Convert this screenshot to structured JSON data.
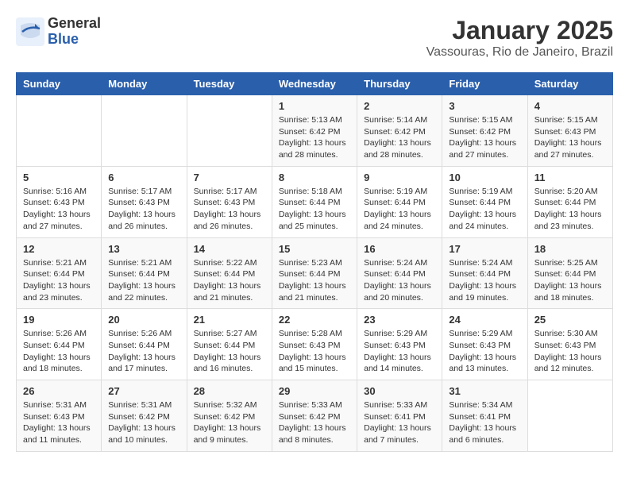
{
  "logo": {
    "general": "General",
    "blue": "Blue"
  },
  "title": "January 2025",
  "subtitle": "Vassouras, Rio de Janeiro, Brazil",
  "headers": [
    "Sunday",
    "Monday",
    "Tuesday",
    "Wednesday",
    "Thursday",
    "Friday",
    "Saturday"
  ],
  "weeks": [
    [
      {
        "day": "",
        "sunrise": "",
        "sunset": "",
        "daylight": ""
      },
      {
        "day": "",
        "sunrise": "",
        "sunset": "",
        "daylight": ""
      },
      {
        "day": "",
        "sunrise": "",
        "sunset": "",
        "daylight": ""
      },
      {
        "day": "1",
        "sunrise": "Sunrise: 5:13 AM",
        "sunset": "Sunset: 6:42 PM",
        "daylight": "Daylight: 13 hours and 28 minutes."
      },
      {
        "day": "2",
        "sunrise": "Sunrise: 5:14 AM",
        "sunset": "Sunset: 6:42 PM",
        "daylight": "Daylight: 13 hours and 28 minutes."
      },
      {
        "day": "3",
        "sunrise": "Sunrise: 5:15 AM",
        "sunset": "Sunset: 6:42 PM",
        "daylight": "Daylight: 13 hours and 27 minutes."
      },
      {
        "day": "4",
        "sunrise": "Sunrise: 5:15 AM",
        "sunset": "Sunset: 6:43 PM",
        "daylight": "Daylight: 13 hours and 27 minutes."
      }
    ],
    [
      {
        "day": "5",
        "sunrise": "Sunrise: 5:16 AM",
        "sunset": "Sunset: 6:43 PM",
        "daylight": "Daylight: 13 hours and 27 minutes."
      },
      {
        "day": "6",
        "sunrise": "Sunrise: 5:17 AM",
        "sunset": "Sunset: 6:43 PM",
        "daylight": "Daylight: 13 hours and 26 minutes."
      },
      {
        "day": "7",
        "sunrise": "Sunrise: 5:17 AM",
        "sunset": "Sunset: 6:43 PM",
        "daylight": "Daylight: 13 hours and 26 minutes."
      },
      {
        "day": "8",
        "sunrise": "Sunrise: 5:18 AM",
        "sunset": "Sunset: 6:44 PM",
        "daylight": "Daylight: 13 hours and 25 minutes."
      },
      {
        "day": "9",
        "sunrise": "Sunrise: 5:19 AM",
        "sunset": "Sunset: 6:44 PM",
        "daylight": "Daylight: 13 hours and 24 minutes."
      },
      {
        "day": "10",
        "sunrise": "Sunrise: 5:19 AM",
        "sunset": "Sunset: 6:44 PM",
        "daylight": "Daylight: 13 hours and 24 minutes."
      },
      {
        "day": "11",
        "sunrise": "Sunrise: 5:20 AM",
        "sunset": "Sunset: 6:44 PM",
        "daylight": "Daylight: 13 hours and 23 minutes."
      }
    ],
    [
      {
        "day": "12",
        "sunrise": "Sunrise: 5:21 AM",
        "sunset": "Sunset: 6:44 PM",
        "daylight": "Daylight: 13 hours and 23 minutes."
      },
      {
        "day": "13",
        "sunrise": "Sunrise: 5:21 AM",
        "sunset": "Sunset: 6:44 PM",
        "daylight": "Daylight: 13 hours and 22 minutes."
      },
      {
        "day": "14",
        "sunrise": "Sunrise: 5:22 AM",
        "sunset": "Sunset: 6:44 PM",
        "daylight": "Daylight: 13 hours and 21 minutes."
      },
      {
        "day": "15",
        "sunrise": "Sunrise: 5:23 AM",
        "sunset": "Sunset: 6:44 PM",
        "daylight": "Daylight: 13 hours and 21 minutes."
      },
      {
        "day": "16",
        "sunrise": "Sunrise: 5:24 AM",
        "sunset": "Sunset: 6:44 PM",
        "daylight": "Daylight: 13 hours and 20 minutes."
      },
      {
        "day": "17",
        "sunrise": "Sunrise: 5:24 AM",
        "sunset": "Sunset: 6:44 PM",
        "daylight": "Daylight: 13 hours and 19 minutes."
      },
      {
        "day": "18",
        "sunrise": "Sunrise: 5:25 AM",
        "sunset": "Sunset: 6:44 PM",
        "daylight": "Daylight: 13 hours and 18 minutes."
      }
    ],
    [
      {
        "day": "19",
        "sunrise": "Sunrise: 5:26 AM",
        "sunset": "Sunset: 6:44 PM",
        "daylight": "Daylight: 13 hours and 18 minutes."
      },
      {
        "day": "20",
        "sunrise": "Sunrise: 5:26 AM",
        "sunset": "Sunset: 6:44 PM",
        "daylight": "Daylight: 13 hours and 17 minutes."
      },
      {
        "day": "21",
        "sunrise": "Sunrise: 5:27 AM",
        "sunset": "Sunset: 6:44 PM",
        "daylight": "Daylight: 13 hours and 16 minutes."
      },
      {
        "day": "22",
        "sunrise": "Sunrise: 5:28 AM",
        "sunset": "Sunset: 6:43 PM",
        "daylight": "Daylight: 13 hours and 15 minutes."
      },
      {
        "day": "23",
        "sunrise": "Sunrise: 5:29 AM",
        "sunset": "Sunset: 6:43 PM",
        "daylight": "Daylight: 13 hours and 14 minutes."
      },
      {
        "day": "24",
        "sunrise": "Sunrise: 5:29 AM",
        "sunset": "Sunset: 6:43 PM",
        "daylight": "Daylight: 13 hours and 13 minutes."
      },
      {
        "day": "25",
        "sunrise": "Sunrise: 5:30 AM",
        "sunset": "Sunset: 6:43 PM",
        "daylight": "Daylight: 13 hours and 12 minutes."
      }
    ],
    [
      {
        "day": "26",
        "sunrise": "Sunrise: 5:31 AM",
        "sunset": "Sunset: 6:43 PM",
        "daylight": "Daylight: 13 hours and 11 minutes."
      },
      {
        "day": "27",
        "sunrise": "Sunrise: 5:31 AM",
        "sunset": "Sunset: 6:42 PM",
        "daylight": "Daylight: 13 hours and 10 minutes."
      },
      {
        "day": "28",
        "sunrise": "Sunrise: 5:32 AM",
        "sunset": "Sunset: 6:42 PM",
        "daylight": "Daylight: 13 hours and 9 minutes."
      },
      {
        "day": "29",
        "sunrise": "Sunrise: 5:33 AM",
        "sunset": "Sunset: 6:42 PM",
        "daylight": "Daylight: 13 hours and 8 minutes."
      },
      {
        "day": "30",
        "sunrise": "Sunrise: 5:33 AM",
        "sunset": "Sunset: 6:41 PM",
        "daylight": "Daylight: 13 hours and 7 minutes."
      },
      {
        "day": "31",
        "sunrise": "Sunrise: 5:34 AM",
        "sunset": "Sunset: 6:41 PM",
        "daylight": "Daylight: 13 hours and 6 minutes."
      },
      {
        "day": "",
        "sunrise": "",
        "sunset": "",
        "daylight": ""
      }
    ]
  ]
}
